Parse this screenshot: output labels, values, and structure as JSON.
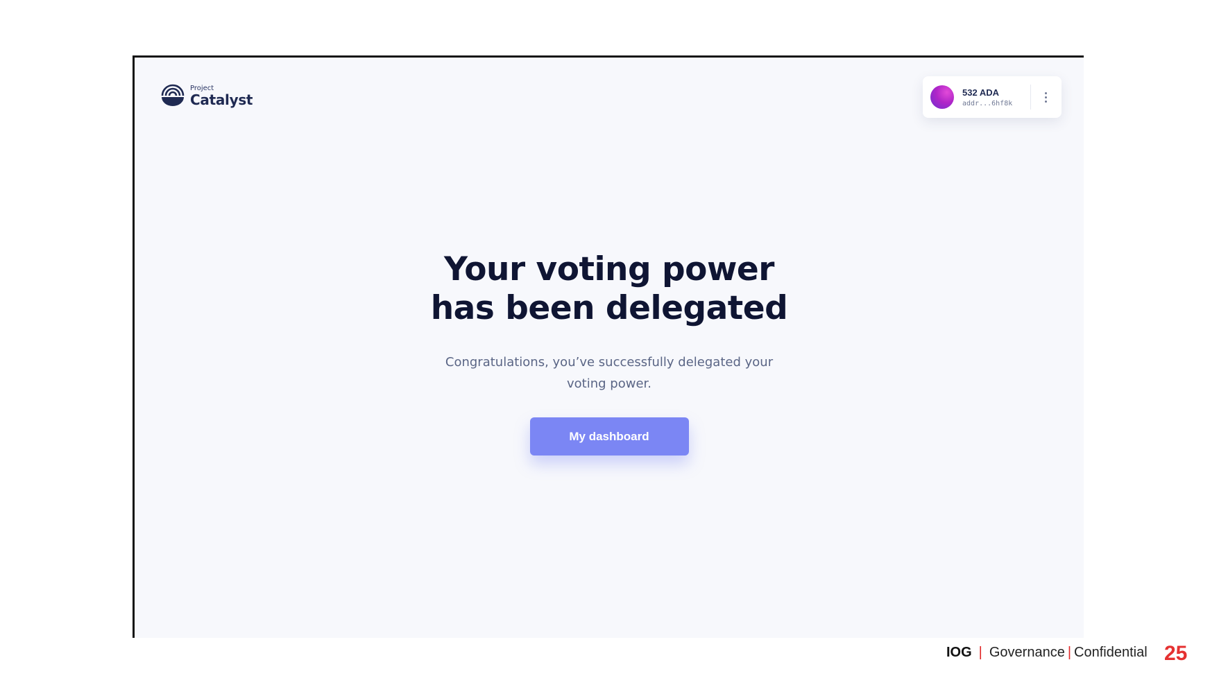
{
  "app": {
    "logo": {
      "small": "Project",
      "big": "Catalyst"
    }
  },
  "wallet": {
    "balance": "532 ADA",
    "address": "addr...6hf8k",
    "menu_icon": "more-vertical-icon"
  },
  "main": {
    "headline_line1": "Your voting power",
    "headline_line2": "has been delegated",
    "subtext_line1": "Congratulations, you’ve successfully delegated your",
    "subtext_line2": "voting power.",
    "cta_label": "My dashboard"
  },
  "footer": {
    "brand": "IOG",
    "sep1": "|",
    "label1": "Governance",
    "sep2": "|",
    "label2": "Confidential",
    "page_number": "25"
  },
  "colors": {
    "accent": "#7b86f4",
    "heading": "#0f1533",
    "page_number": "#e53131"
  }
}
